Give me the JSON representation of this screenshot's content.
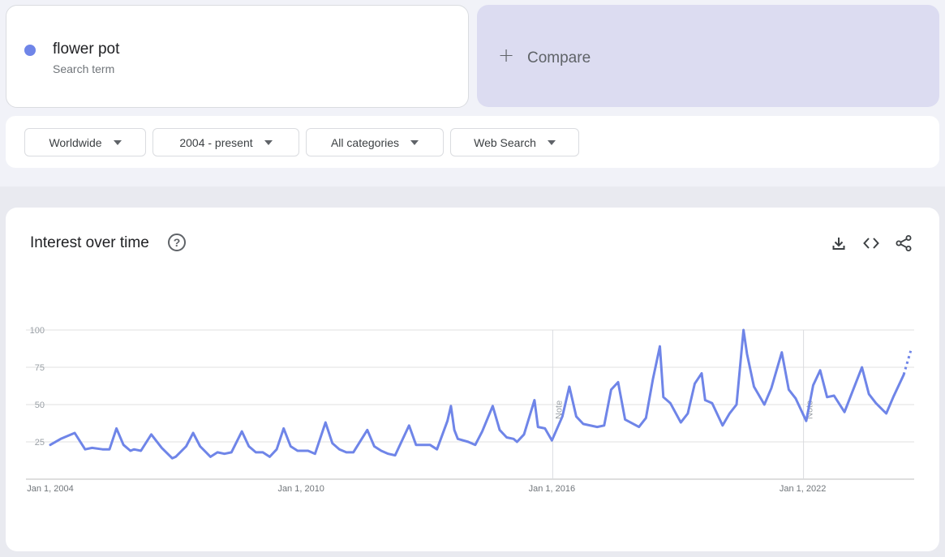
{
  "search": {
    "term": "flower pot",
    "term_type": "Search term",
    "term_color": "#6f85e8",
    "compare_label": "Compare",
    "compare_icon": "plus-icon"
  },
  "filters": [
    {
      "label": "Worldwide"
    },
    {
      "label": "2004 - present"
    },
    {
      "label": "All categories"
    },
    {
      "label": "Web Search"
    }
  ],
  "card": {
    "title": "Interest over time",
    "help_icon": "help-icon",
    "help_glyph": "?",
    "actions": [
      "download-icon",
      "embed-icon",
      "share-icon"
    ]
  },
  "chart_data": {
    "type": "line",
    "title": "Interest over time",
    "ylim": [
      0,
      100
    ],
    "yticks": [
      25,
      50,
      75,
      100
    ],
    "xticks": [
      "Jan 1, 2004",
      "Jan 1, 2010",
      "Jan 1, 2016",
      "Jan 1, 2022"
    ],
    "grid": true,
    "notes": [
      {
        "date": "2016-01",
        "label": "Note"
      },
      {
        "date": "2022-01",
        "label": "Note"
      }
    ],
    "series": [
      {
        "name": "flower pot",
        "color": "#6f85e8",
        "partial_last_point": true,
        "points": [
          [
            "2004-01",
            23
          ],
          [
            "2004-04",
            27
          ],
          [
            "2004-08",
            31
          ],
          [
            "2004-11",
            20
          ],
          [
            "2005-01",
            21
          ],
          [
            "2005-04",
            20
          ],
          [
            "2005-06",
            20
          ],
          [
            "2005-08",
            34
          ],
          [
            "2005-10",
            23
          ],
          [
            "2005-12",
            19
          ],
          [
            "2006-01",
            20
          ],
          [
            "2006-03",
            19
          ],
          [
            "2006-06",
            30
          ],
          [
            "2006-09",
            21
          ],
          [
            "2006-12",
            14
          ],
          [
            "2007-01",
            15
          ],
          [
            "2007-04",
            22
          ],
          [
            "2007-06",
            31
          ],
          [
            "2007-08",
            22
          ],
          [
            "2007-11",
            15
          ],
          [
            "2008-01",
            18
          ],
          [
            "2008-03",
            17
          ],
          [
            "2008-05",
            18
          ],
          [
            "2008-08",
            32
          ],
          [
            "2008-10",
            22
          ],
          [
            "2008-12",
            18
          ],
          [
            "2009-02",
            18
          ],
          [
            "2009-04",
            15
          ],
          [
            "2009-06",
            20
          ],
          [
            "2009-08",
            34
          ],
          [
            "2009-10",
            22
          ],
          [
            "2009-12",
            19
          ],
          [
            "2010-03",
            19
          ],
          [
            "2010-05",
            17
          ],
          [
            "2010-08",
            38
          ],
          [
            "2010-10",
            24
          ],
          [
            "2010-12",
            20
          ],
          [
            "2011-02",
            18
          ],
          [
            "2011-04",
            18
          ],
          [
            "2011-08",
            33
          ],
          [
            "2011-10",
            22
          ],
          [
            "2011-12",
            19
          ],
          [
            "2012-02",
            17
          ],
          [
            "2012-04",
            16
          ],
          [
            "2012-08",
            36
          ],
          [
            "2012-10",
            23
          ],
          [
            "2012-12",
            23
          ],
          [
            "2013-02",
            23
          ],
          [
            "2013-04",
            20
          ],
          [
            "2013-07",
            39
          ],
          [
            "2013-08",
            49
          ],
          [
            "2013-09",
            33
          ],
          [
            "2013-10",
            27
          ],
          [
            "2014-01",
            25
          ],
          [
            "2014-03",
            23
          ],
          [
            "2014-05",
            32
          ],
          [
            "2014-08",
            49
          ],
          [
            "2014-10",
            33
          ],
          [
            "2014-12",
            28
          ],
          [
            "2015-02",
            27
          ],
          [
            "2015-03",
            25
          ],
          [
            "2015-05",
            30
          ],
          [
            "2015-08",
            53
          ],
          [
            "2015-09",
            35
          ],
          [
            "2015-11",
            34
          ],
          [
            "2016-01",
            26
          ],
          [
            "2016-04",
            42
          ],
          [
            "2016-06",
            62
          ],
          [
            "2016-08",
            42
          ],
          [
            "2016-10",
            37
          ],
          [
            "2017-02",
            35
          ],
          [
            "2017-04",
            36
          ],
          [
            "2017-06",
            60
          ],
          [
            "2017-08",
            65
          ],
          [
            "2017-10",
            40
          ],
          [
            "2018-02",
            35
          ],
          [
            "2018-04",
            41
          ],
          [
            "2018-06",
            67
          ],
          [
            "2018-08",
            89
          ],
          [
            "2018-09",
            55
          ],
          [
            "2018-11",
            51
          ],
          [
            "2019-02",
            38
          ],
          [
            "2019-04",
            44
          ],
          [
            "2019-06",
            64
          ],
          [
            "2019-08",
            71
          ],
          [
            "2019-09",
            53
          ],
          [
            "2019-11",
            51
          ],
          [
            "2020-02",
            36
          ],
          [
            "2020-04",
            44
          ],
          [
            "2020-06",
            50
          ],
          [
            "2020-08",
            100
          ],
          [
            "2020-09",
            84
          ],
          [
            "2020-11",
            62
          ],
          [
            "2021-02",
            50
          ],
          [
            "2021-04",
            61
          ],
          [
            "2021-07",
            85
          ],
          [
            "2021-09",
            60
          ],
          [
            "2021-11",
            54
          ],
          [
            "2022-02",
            39
          ],
          [
            "2022-04",
            63
          ],
          [
            "2022-06",
            73
          ],
          [
            "2022-08",
            55
          ],
          [
            "2022-10",
            56
          ],
          [
            "2023-01",
            45
          ],
          [
            "2023-03",
            57
          ],
          [
            "2023-06",
            75
          ],
          [
            "2023-08",
            57
          ],
          [
            "2023-10",
            51
          ],
          [
            "2024-01",
            44
          ],
          [
            "2024-03",
            55
          ],
          [
            "2024-06",
            70
          ],
          [
            "2024-08",
            86
          ]
        ]
      }
    ]
  }
}
